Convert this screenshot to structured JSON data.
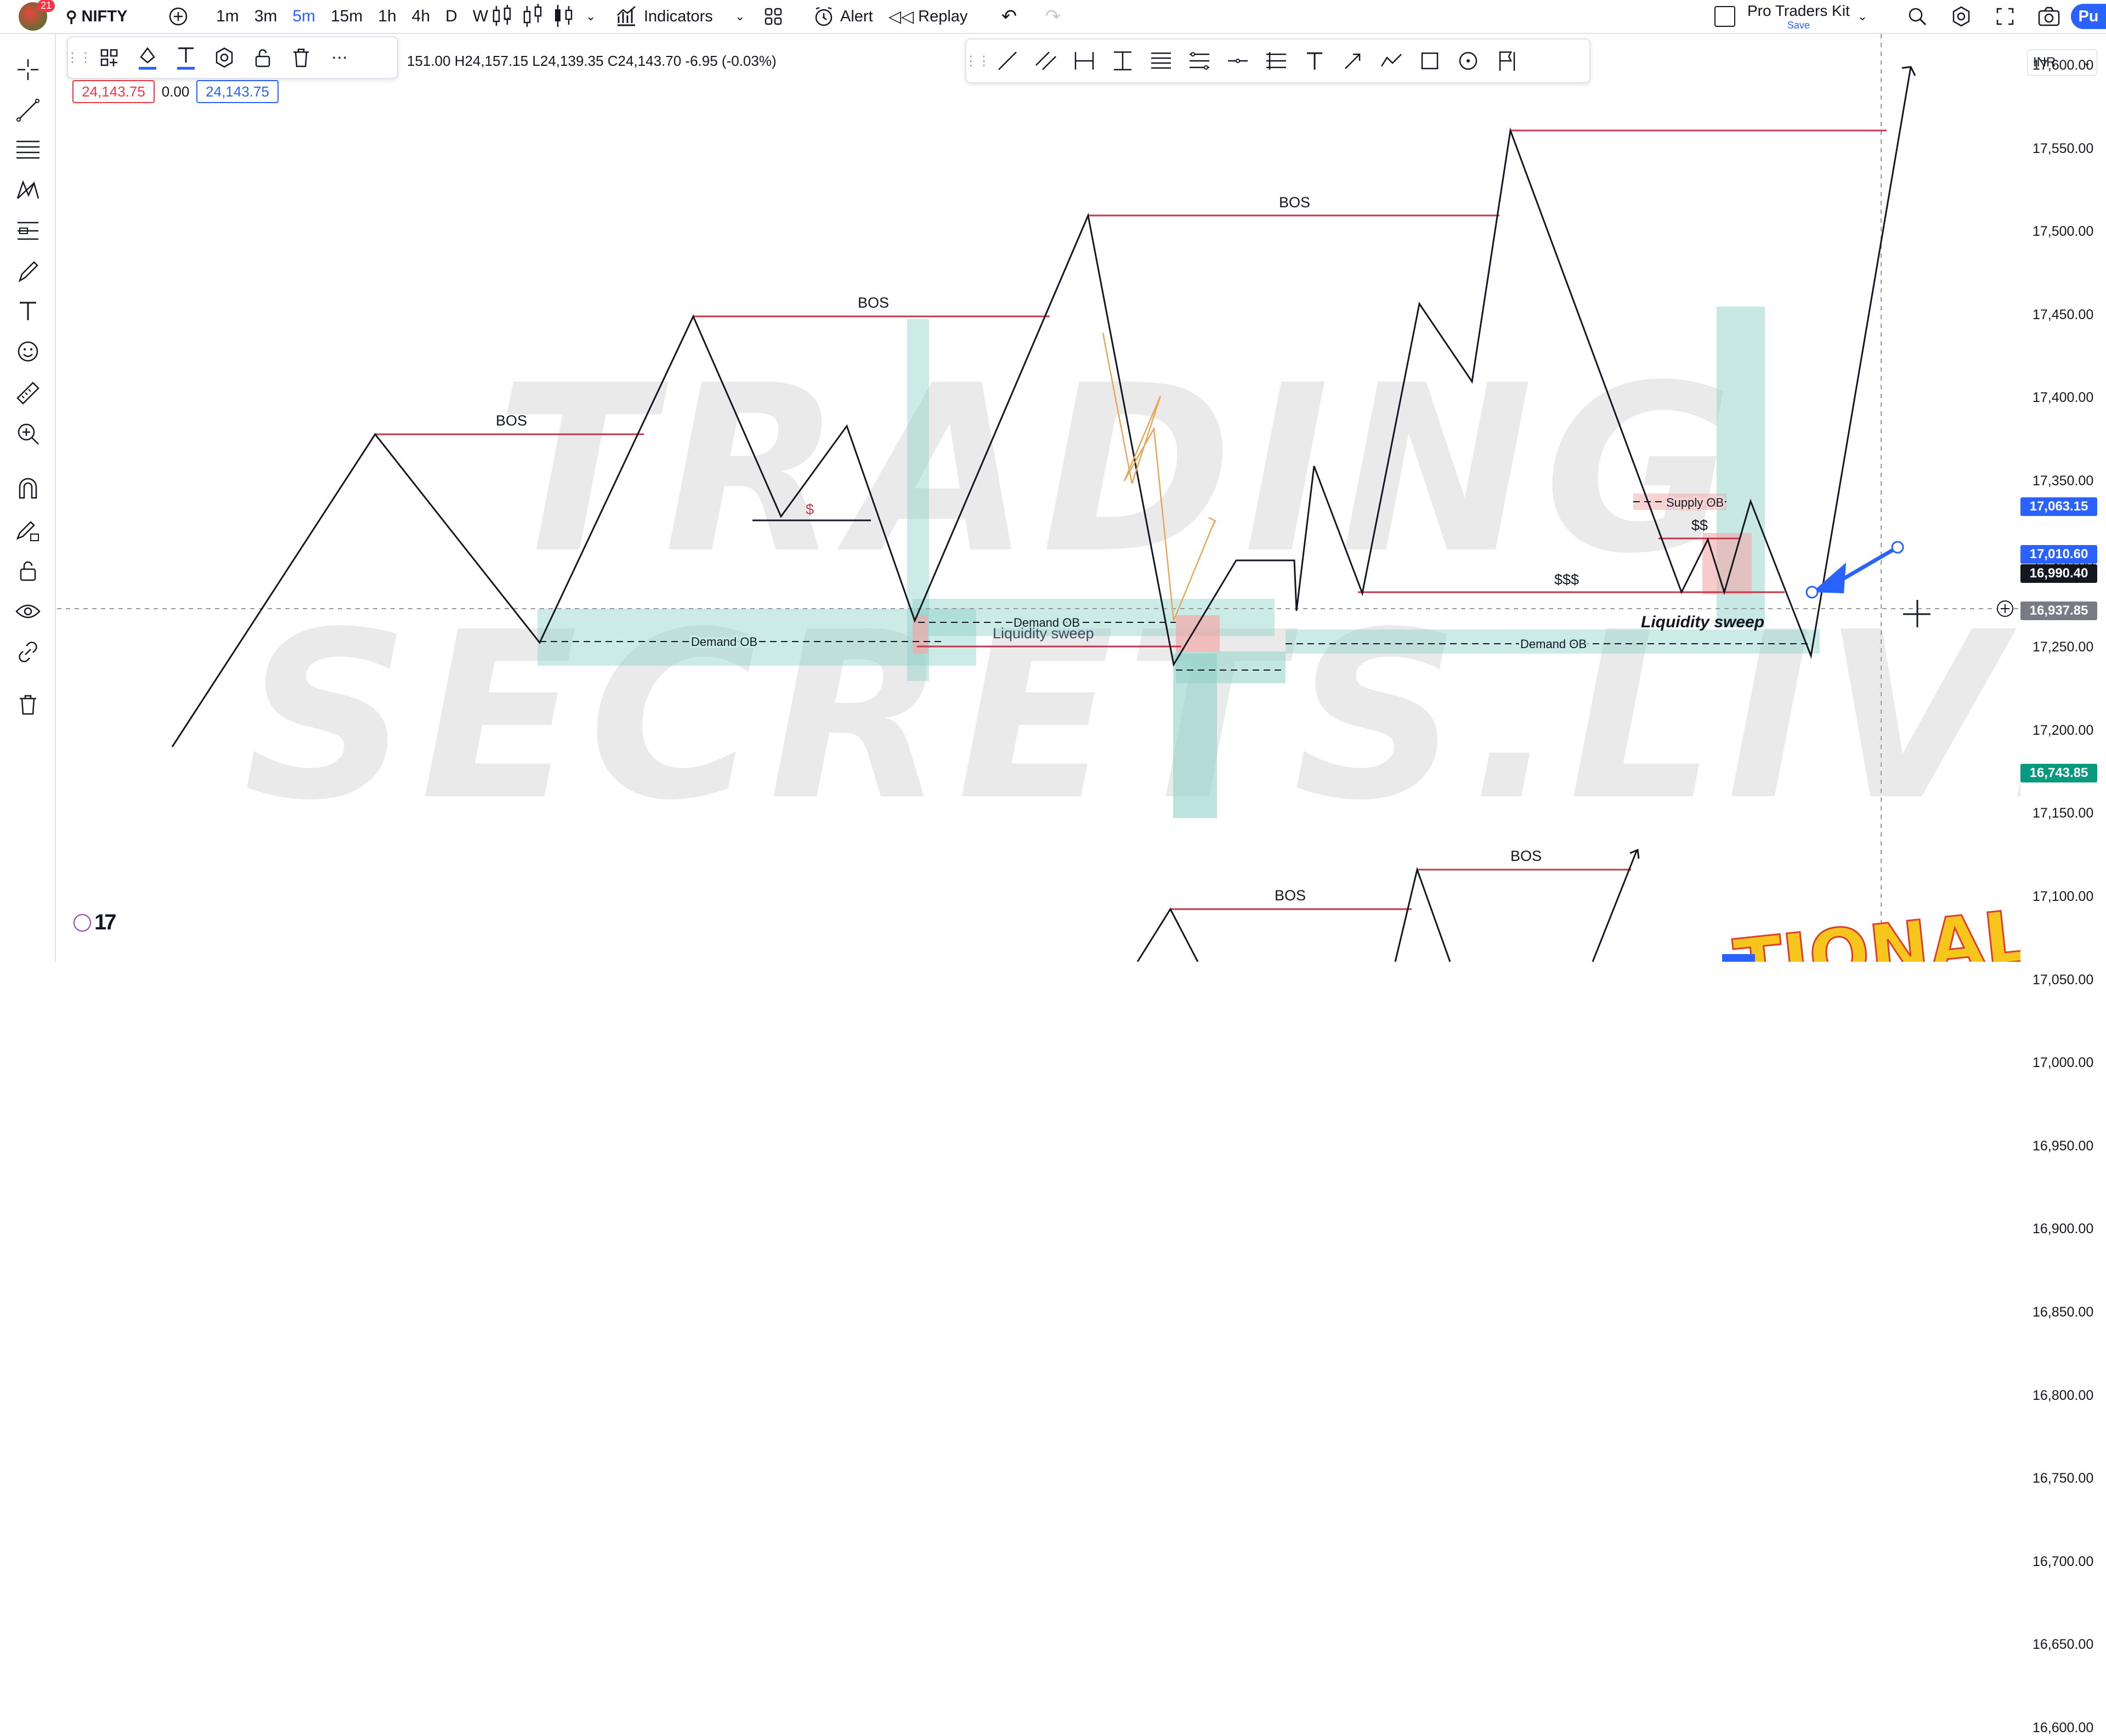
{
  "header": {
    "notification_count": "21",
    "symbol": "NIFTY",
    "intervals": [
      "1m",
      "3m",
      "5m",
      "15m",
      "1h",
      "4h",
      "D",
      "W"
    ],
    "active_interval": "5m",
    "indicators_label": "Indicators",
    "alert_label": "Alert",
    "replay_label": "Replay",
    "layout_name": "Pro Traders Kit",
    "layout_save": "Save",
    "publish_label": "Pu"
  },
  "legend": {
    "ohlc": "151.00 H24,157.15 L24,139.35 C24,143.70 -6.95 (-0.03%)",
    "sell_price": "24,143.75",
    "spread": "0.00",
    "buy_price": "24,143.75"
  },
  "price_axis": {
    "currency": "INR",
    "ticks": [
      "17,600.00",
      "17,550.00",
      "17,500.00",
      "17,450.00",
      "17,400.00",
      "17,350.00",
      "17,300.00",
      "17,250.00",
      "17,200.00",
      "17,150.00",
      "17,100.00",
      "17,050.00",
      "17,000.00",
      "16,950.00",
      "16,900.00",
      "16,850.00",
      "16,800.00",
      "16,750.00",
      "16,700.00",
      "16,650.00",
      "16,600.00"
    ],
    "labels": [
      {
        "text": "17,063.15",
        "color": "#2962ff"
      },
      {
        "text": "17,010.60",
        "color": "#2962ff"
      },
      {
        "text": "16,990.40",
        "color": "#131722"
      },
      {
        "text": "16,937.85",
        "color": "#787b86"
      },
      {
        "text": "16,743.85",
        "color": "#089981"
      }
    ]
  },
  "annotations": {
    "bos": [
      "BOS",
      "BOS",
      "BOS",
      "BOS",
      "BOS"
    ],
    "demand_ob": [
      "Demand OB",
      "Demand OB",
      "Demand OB"
    ],
    "supply_ob": "Supply OB",
    "liquidity_sweep": [
      "Liquidity sweep",
      "Liquidity sweep"
    ],
    "dollar_one": "$",
    "dollar_two": "$$",
    "dollar_three": "$$$"
  },
  "watermark": {
    "line1": "TRADING",
    "line2": "SECRETS.LIVE",
    "corner": "TIONAL"
  },
  "branding": {
    "logo": "17"
  },
  "colors": {
    "accent": "#2962ff",
    "bos_line": "#c2384a",
    "zone_teal": "#8fd1c7",
    "zone_red": "#f2a8a8",
    "buy_green": "#089981"
  }
}
